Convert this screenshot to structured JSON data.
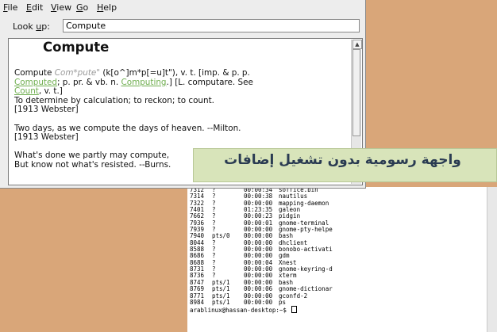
{
  "menu": {
    "file": {
      "accel": "F",
      "rest": "ile"
    },
    "edit": {
      "accel": "E",
      "rest": "dit"
    },
    "view": {
      "accel": "V",
      "rest": "iew"
    },
    "go": {
      "accel": "G",
      "rest": "o"
    },
    "help": {
      "accel": "H",
      "rest": "elp"
    }
  },
  "lookup": {
    "label_pre": "Look ",
    "label_accel": "u",
    "label_post": "p:",
    "value": "Compute"
  },
  "definition": {
    "headword": "Compute",
    "line1_word": "Compute",
    "line1_pron": "Com*pute\"",
    "line1_rest": " (k[o^]m*p[=u]t\"), v. t. [imp. & p. p.",
    "link_computed": "Computed",
    "line2_mid": "; p. pr. & vb. n. ",
    "link_computing": "Computing",
    "line2_end": ".] [L. computare. See",
    "link_count": "Count",
    "line3_end": ", v. t.]",
    "meaning": "To determine by calculation; to reckon; to count.",
    "source1": "[1913 Webster]",
    "quote1": "Two days, as we compute the days of heaven. --Milton.",
    "source2": "[1913 Webster]",
    "quote2a": "What's done we partly may compute,",
    "quote2b": "But know not what's resisted. --Burns."
  },
  "banner": {
    "text": "واجهة رسومية بدون تشغيل إضافات"
  },
  "terminal": {
    "processes": [
      {
        "pid": "7312",
        "tty": "?",
        "time": "00:00:34",
        "cmd": "soffice.bin"
      },
      {
        "pid": "7314",
        "tty": "?",
        "time": "00:00:38",
        "cmd": "nautilus"
      },
      {
        "pid": "7322",
        "tty": "?",
        "time": "00:00:00",
        "cmd": "mapping-daemon"
      },
      {
        "pid": "7401",
        "tty": "?",
        "time": "01:23:35",
        "cmd": "galeon"
      },
      {
        "pid": "7662",
        "tty": "?",
        "time": "00:00:23",
        "cmd": "pidgin"
      },
      {
        "pid": "7936",
        "tty": "?",
        "time": "00:00:01",
        "cmd": "gnome-terminal"
      },
      {
        "pid": "7939",
        "tty": "?",
        "time": "00:00:00",
        "cmd": "gnome-pty-helpe"
      },
      {
        "pid": "7940",
        "tty": "pts/0",
        "time": "00:00:00",
        "cmd": "bash"
      },
      {
        "pid": "8044",
        "tty": "?",
        "time": "00:00:00",
        "cmd": "dhclient"
      },
      {
        "pid": "8588",
        "tty": "?",
        "time": "00:00:00",
        "cmd": "bonobo-activati"
      },
      {
        "pid": "8686",
        "tty": "?",
        "time": "00:00:00",
        "cmd": "gdm"
      },
      {
        "pid": "8688",
        "tty": "?",
        "time": "00:00:04",
        "cmd": "Xnest"
      },
      {
        "pid": "8731",
        "tty": "?",
        "time": "00:00:00",
        "cmd": "gnome-keyring-d"
      },
      {
        "pid": "8736",
        "tty": "?",
        "time": "00:00:00",
        "cmd": "xterm"
      },
      {
        "pid": "8747",
        "tty": "pts/1",
        "time": "00:00:00",
        "cmd": "bash"
      },
      {
        "pid": "8769",
        "tty": "pts/1",
        "time": "00:00:06",
        "cmd": "gnome-dictionar"
      },
      {
        "pid": "8771",
        "tty": "pts/1",
        "time": "00:00:00",
        "cmd": "gconfd-2"
      },
      {
        "pid": "8984",
        "tty": "pts/1",
        "time": "00:00:00",
        "cmd": "ps"
      }
    ],
    "prompt": "arablinux@hassan-desktop:~$"
  }
}
